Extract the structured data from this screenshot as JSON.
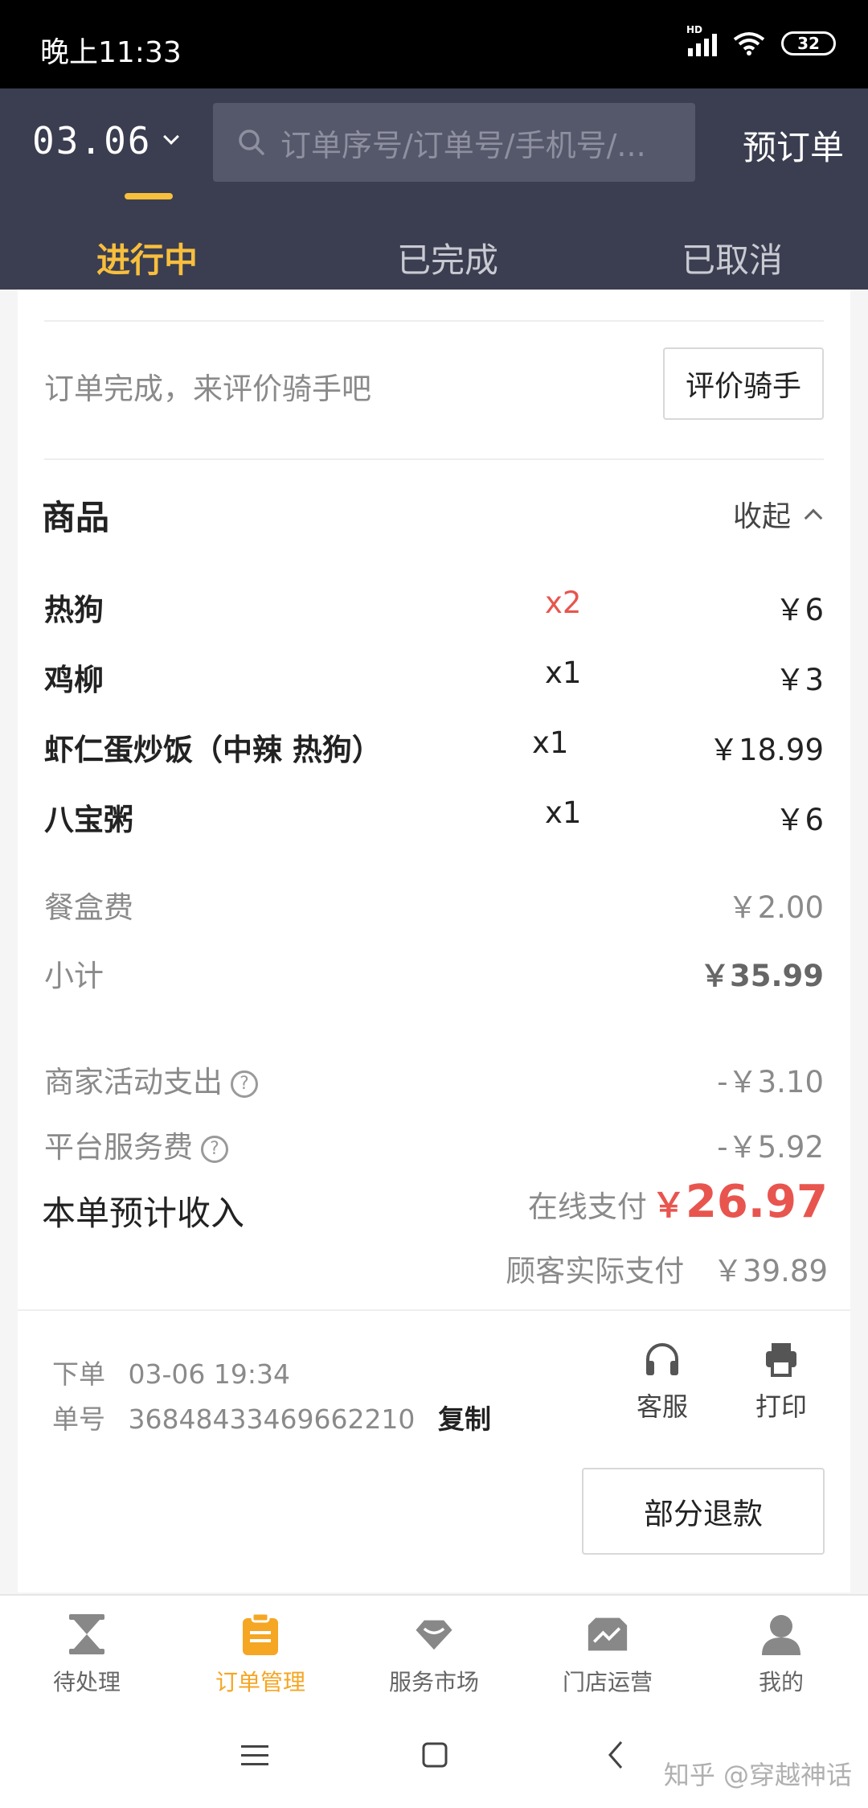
{
  "status_bar": {
    "time": "晚上11:33",
    "battery": "32"
  },
  "header": {
    "date": "03.06",
    "search_placeholder": "订单序号/订单号/手机号/...",
    "preorder": "预订单",
    "tabs": [
      {
        "label": "进行中",
        "active": true
      },
      {
        "label": "已完成",
        "active": false
      },
      {
        "label": "已取消",
        "active": false
      }
    ]
  },
  "rating": {
    "prompt": "订单完成，来评价骑手吧",
    "button": "评价骑手"
  },
  "goods": {
    "title": "商品",
    "collapse": "收起",
    "items": [
      {
        "name": "热狗",
        "qty": "x2",
        "price": "￥6"
      },
      {
        "name": "鸡柳",
        "qty": "x1",
        "price": "￥3"
      },
      {
        "name": "虾仁蛋炒饭（中辣 热狗）",
        "qty": "x1",
        "price": "￥18.99"
      },
      {
        "name": "八宝粥",
        "qty": "x1",
        "price": "￥6"
      }
    ],
    "box_fee_label": "餐盒费",
    "box_fee": "￥2.00",
    "subtotal_label": "小计",
    "subtotal": "￥35.99"
  },
  "fees": {
    "merchant_label": "商家活动支出",
    "merchant_value": "-￥3.10",
    "platform_label": "平台服务费",
    "platform_value": "-￥5.92",
    "income_label": "本单预计收入",
    "online_label": "在线支付",
    "income_currency": "￥",
    "income_value": "26.97",
    "customer_label": "顾客实际支付",
    "customer_value": "￥39.89"
  },
  "order": {
    "time_label": "下单",
    "time_value": "03-06 19:34",
    "no_label": "单号",
    "no_value": "36848433469662210",
    "copy": "复制",
    "service": "客服",
    "print": "打印",
    "refund": "部分退款"
  },
  "bottom_nav": [
    {
      "label": "待处理",
      "icon": "hourglass-icon",
      "active": false
    },
    {
      "label": "订单管理",
      "icon": "clipboard-icon",
      "active": true
    },
    {
      "label": "服务市场",
      "icon": "market-icon",
      "active": false
    },
    {
      "label": "门店运营",
      "icon": "chart-icon",
      "active": false
    },
    {
      "label": "我的",
      "icon": "person-icon",
      "active": false
    }
  ],
  "watermark": "知乎 @穿越神话",
  "colors": {
    "header_bg": "#3b3e50",
    "accent": "#f8bf3d",
    "price_red": "#e8554e"
  }
}
